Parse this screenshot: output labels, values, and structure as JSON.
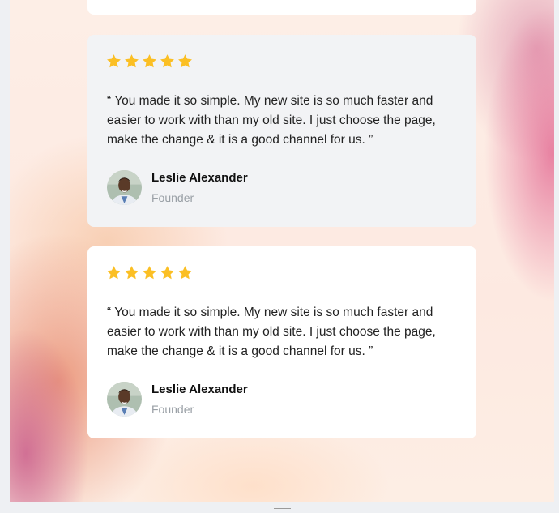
{
  "colors": {
    "star": "#fbbf24",
    "card_grey": "#f2f3f5",
    "card_white": "#ffffff",
    "role_text": "#9aa0a6"
  },
  "testimonials": [
    {
      "rating": 5,
      "quote": "“ You made it so simple. My new site is so much faster and easier to work with than my old site. I just choose the page, make the change & it is a good channel for us. ”",
      "author": "Leslie Alexander",
      "role": "Founder",
      "avatar_icon": "person-avatar"
    },
    {
      "rating": 5,
      "quote": "“ You made it so simple. My new site is so much faster and easier to work with than my old site. I just choose the page, make the change & it is a good channel for us. ”",
      "author": "Leslie Alexander",
      "role": "Founder",
      "avatar_icon": "person-avatar"
    }
  ]
}
